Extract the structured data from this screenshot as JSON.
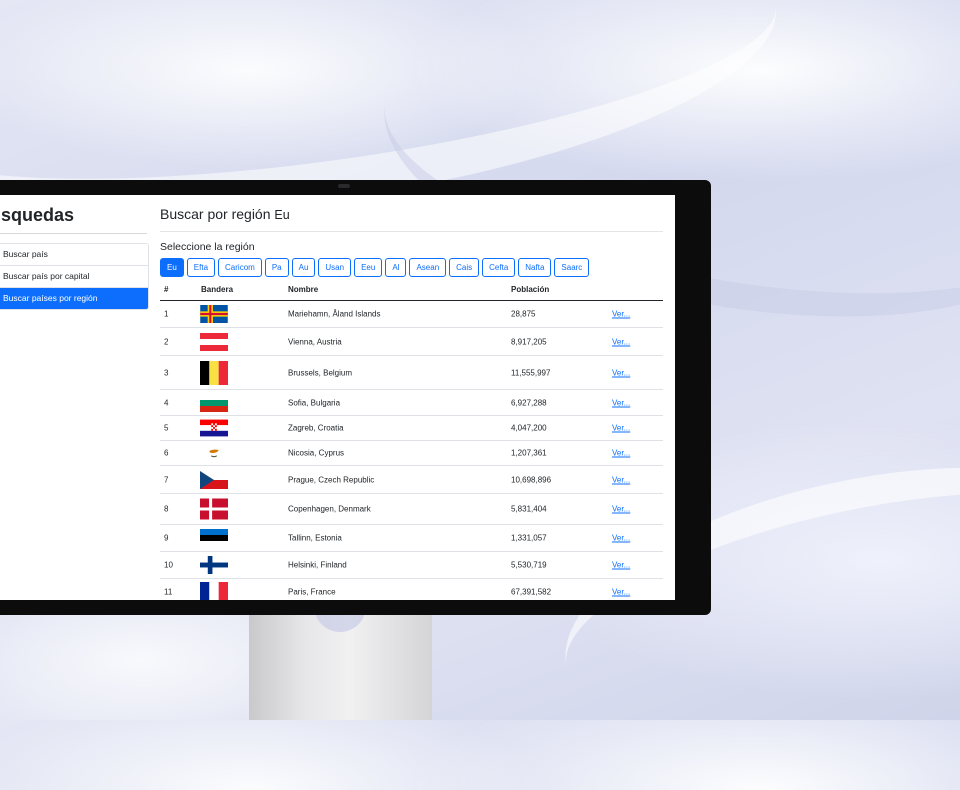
{
  "sidebar": {
    "title": "úsquedas",
    "items": [
      {
        "label": "Buscar país",
        "active": false
      },
      {
        "label": "Buscar país por capital",
        "active": false
      },
      {
        "label": "Buscar países por región",
        "active": true
      }
    ]
  },
  "main": {
    "title": "Buscar por región",
    "title_region": "Eu",
    "select_label": "Seleccione la región",
    "regions": [
      "Eu",
      "Efta",
      "Caricom",
      "Pa",
      "Au",
      "Usan",
      "Eeu",
      "Al",
      "Asean",
      "Cais",
      "Cefta",
      "Nafta",
      "Saarc"
    ],
    "active_region": "Eu",
    "table": {
      "headers": [
        "#",
        "Bandera",
        "Nombre",
        "Población",
        ""
      ],
      "rows": [
        {
          "num": "1",
          "flag": "aland-islands-flag-icon",
          "name": "Mariehamn, Åland Islands",
          "population": "28,875",
          "link": "Ver..."
        },
        {
          "num": "2",
          "flag": "austria-flag-icon",
          "name": "Vienna, Austria",
          "population": "8,917,205",
          "link": "Ver..."
        },
        {
          "num": "3",
          "flag": "belgium-flag-icon",
          "name": "Brussels, Belgium",
          "population": "11,555,997",
          "link": "Ver..."
        },
        {
          "num": "4",
          "flag": "bulgaria-flag-icon",
          "name": "Sofia, Bulgaria",
          "population": "6,927,288",
          "link": "Ver..."
        },
        {
          "num": "5",
          "flag": "croatia-flag-icon",
          "name": "Zagreb, Croatia",
          "population": "4,047,200",
          "link": "Ver..."
        },
        {
          "num": "6",
          "flag": "cyprus-flag-icon",
          "name": "Nicosia, Cyprus",
          "population": "1,207,361",
          "link": "Ver..."
        },
        {
          "num": "7",
          "flag": "czech-republic-flag-icon",
          "name": "Prague, Czech Republic",
          "population": "10,698,896",
          "link": "Ver..."
        },
        {
          "num": "8",
          "flag": "denmark-flag-icon",
          "name": "Copenhagen, Denmark",
          "population": "5,831,404",
          "link": "Ver..."
        },
        {
          "num": "9",
          "flag": "estonia-flag-icon",
          "name": "Tallinn, Estonia",
          "population": "1,331,057",
          "link": "Ver..."
        },
        {
          "num": "10",
          "flag": "finland-flag-icon",
          "name": "Helsinki, Finland",
          "population": "5,530,719",
          "link": "Ver..."
        },
        {
          "num": "11",
          "flag": "france-flag-icon",
          "name": "Paris, France",
          "population": "67,391,582",
          "link": "Ver..."
        }
      ]
    }
  },
  "colors": {
    "accent": "#0d6efd",
    "bezel": "#0c0c0d"
  }
}
